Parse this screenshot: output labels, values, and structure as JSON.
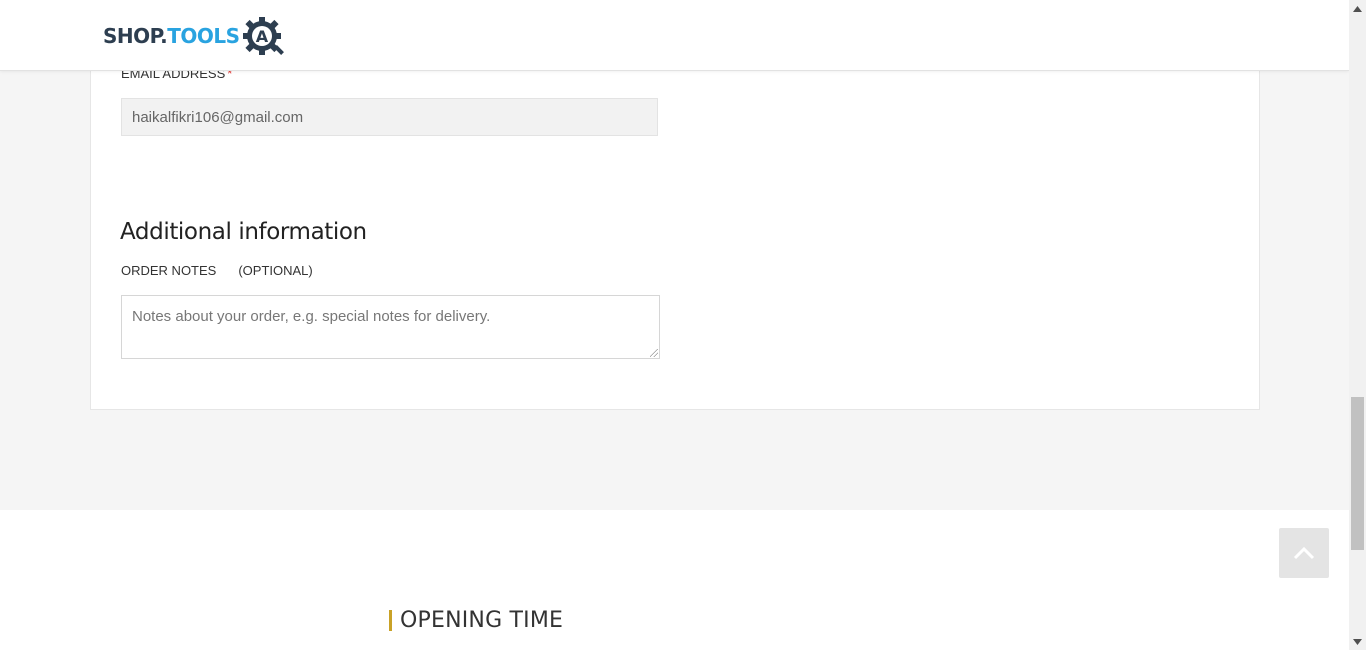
{
  "header": {
    "logo_part1": "SHOP.",
    "logo_part2": "TOOLS",
    "logo_badge": "A"
  },
  "form": {
    "email_label": "EMAIL ADDRESS",
    "required_mark": "*",
    "email_value": "haikalfikri106@gmail.com",
    "section_title": "Additional information",
    "notes_label": "ORDER NOTES",
    "notes_optional": "(OPTIONAL)",
    "notes_placeholder": "Notes about your order, e.g. special notes for delivery."
  },
  "footer": {
    "opening_title": "OPENING TIME"
  },
  "icons": {
    "back_to_top": "chevron-up-icon",
    "logo": "gear-icon"
  },
  "colors": {
    "accent_gold": "#c9a227",
    "logo_blue": "#29a3e0",
    "logo_dark": "#2d3e50",
    "required": "#e53935"
  }
}
